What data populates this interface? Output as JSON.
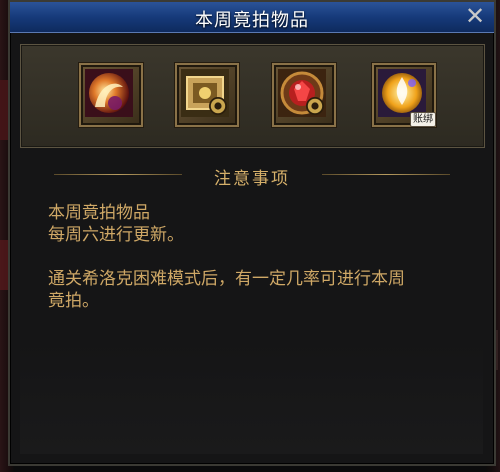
{
  "window": {
    "title": "本周竟拍物品",
    "close_label": "✕"
  },
  "items": [
    {
      "icon": "crescent-orb-icon"
    },
    {
      "icon": "treasure-box-icon",
      "badge_icon": "coin-icon"
    },
    {
      "icon": "red-crystal-icon",
      "badge_icon": "coin-icon"
    },
    {
      "icon": "white-flame-icon",
      "badge": "账绑"
    }
  ],
  "notice": {
    "title": "注意事项",
    "line1": "本周竟拍物品",
    "line2": "每周六进行更新。",
    "line3": "通关希洛克困难模式后，有一定几率可进行本周",
    "line4": "竟拍。"
  }
}
